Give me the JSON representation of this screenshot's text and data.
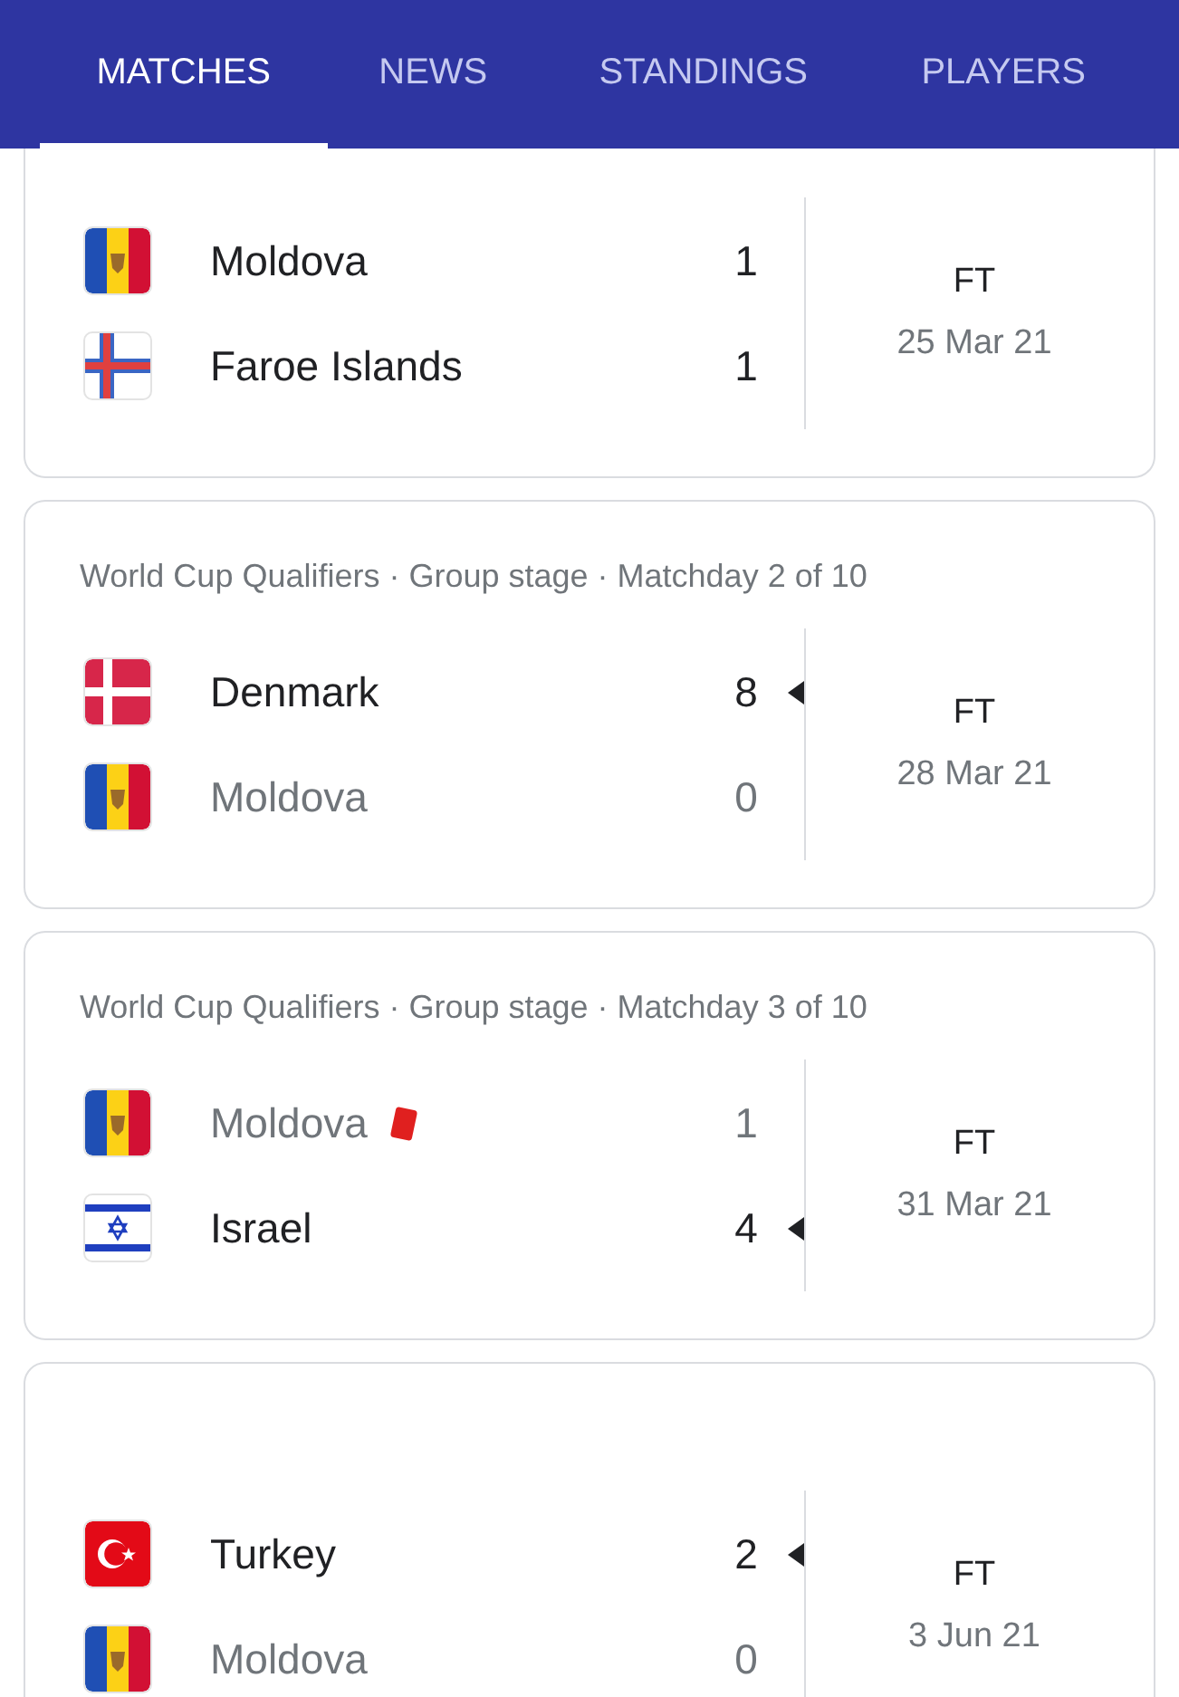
{
  "tabs": [
    {
      "label": "MATCHES",
      "selected": true
    },
    {
      "label": "NEWS",
      "selected": false
    },
    {
      "label": "STANDINGS",
      "selected": false
    },
    {
      "label": "PLAYERS",
      "selected": false
    }
  ],
  "matches": [
    {
      "teams": [
        {
          "kind": "moldova",
          "name": "Moldova",
          "score": "1",
          "dimmed": false,
          "winner": false,
          "red_card": false
        },
        {
          "kind": "faroe",
          "name": "Faroe Islands",
          "score": "1",
          "dimmed": false,
          "winner": false,
          "red_card": false
        }
      ],
      "status": "FT",
      "date": "25 Mar 21"
    },
    {
      "header": "World Cup Qualifiers · Group stage · Matchday 2 of 10",
      "teams": [
        {
          "kind": "denmark",
          "name": "Denmark",
          "score": "8",
          "dimmed": false,
          "winner": true,
          "red_card": false
        },
        {
          "kind": "moldova",
          "name": "Moldova",
          "score": "0",
          "dimmed": true,
          "winner": false,
          "red_card": false
        }
      ],
      "status": "FT",
      "date": "28 Mar 21"
    },
    {
      "header": "World Cup Qualifiers · Group stage · Matchday 3 of 10",
      "teams": [
        {
          "kind": "moldova",
          "name": "Moldova",
          "score": "1",
          "dimmed": true,
          "winner": false,
          "red_card": true
        },
        {
          "kind": "israel",
          "name": "Israel",
          "score": "4",
          "dimmed": false,
          "winner": true,
          "red_card": false
        }
      ],
      "status": "FT",
      "date": "31 Mar 21"
    },
    {
      "teams": [
        {
          "kind": "turkey",
          "name": "Turkey",
          "score": "2",
          "dimmed": false,
          "winner": true,
          "red_card": false
        },
        {
          "kind": "moldova",
          "name": "Moldova",
          "score": "0",
          "dimmed": true,
          "winner": false,
          "red_card": false
        }
      ],
      "status": "FT",
      "date": "3 Jun 21"
    }
  ]
}
